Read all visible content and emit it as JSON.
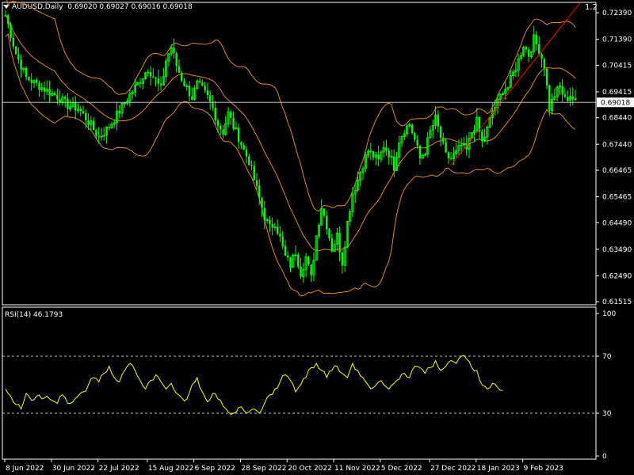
{
  "header": {
    "symbol": "AUDUSD,Daily",
    "ohlc": "0.69020 0.69027 0.69016 0.69018"
  },
  "corner_label": "1.2",
  "rsi": {
    "label": "RSI(14) 46.1793",
    "levels": [
      100,
      70,
      30,
      0
    ],
    "period": 14,
    "value": 46.1793
  },
  "colors": {
    "bg": "#000000",
    "candle": "#00ff00",
    "bands": "#e08a1e",
    "rsi": "#ffff00",
    "trend": "#ff0000",
    "grid": "#ffffff",
    "price_line": "#c0c0c0"
  },
  "chart_data": {
    "type": "candlestick",
    "price_axis": {
      "ticks": [
        "0.72390",
        "0.71390",
        "0.70415",
        "0.69415",
        "0.68440",
        "0.67440",
        "0.66465",
        "0.65465",
        "0.64490",
        "0.63490",
        "0.62490",
        "0.61515"
      ],
      "range": [
        0.614,
        0.7278
      ],
      "current_price": "0.69018"
    },
    "time_axis": [
      "8 Jun 2022",
      "30 Jun 2022",
      "22 Jul 2022",
      "15 Aug 2022",
      "6 Sep 2022",
      "28 Sep 2022",
      "20 Oct 2022",
      "11 Nov 2022",
      "5 Dec 2022",
      "27 Dec 2022",
      "18 Jan 2023",
      "9 Feb 2023"
    ],
    "close_path": [
      [
        0,
        0.723
      ],
      [
        4,
        0.7085
      ],
      [
        8,
        0.6995
      ],
      [
        12,
        0.697
      ],
      [
        16,
        0.6945
      ],
      [
        20,
        0.6925
      ],
      [
        24,
        0.689
      ],
      [
        28,
        0.688
      ],
      [
        30,
        0.6855
      ],
      [
        33,
        0.6815
      ],
      [
        36,
        0.677
      ],
      [
        40,
        0.681
      ],
      [
        44,
        0.687
      ],
      [
        48,
        0.693
      ],
      [
        52,
        0.6985
      ],
      [
        55,
        0.703
      ],
      [
        58,
        0.6985
      ],
      [
        60,
        0.695
      ],
      [
        62,
        0.706
      ],
      [
        64,
        0.711
      ],
      [
        66,
        0.704
      ],
      [
        68,
        0.699
      ],
      [
        70,
        0.6955
      ],
      [
        72,
        0.692
      ],
      [
        74,
        0.697
      ],
      [
        76,
        0.695
      ],
      [
        78,
        0.692
      ],
      [
        80,
        0.688
      ],
      [
        82,
        0.682
      ],
      [
        84,
        0.679
      ],
      [
        86,
        0.686
      ],
      [
        88,
        0.681
      ],
      [
        90,
        0.677
      ],
      [
        92,
        0.672
      ],
      [
        94,
        0.668
      ],
      [
        96,
        0.661
      ],
      [
        98,
        0.654
      ],
      [
        100,
        0.647
      ],
      [
        102,
        0.643
      ],
      [
        104,
        0.645
      ],
      [
        106,
        0.639
      ],
      [
        108,
        0.632
      ],
      [
        110,
        0.629
      ],
      [
        112,
        0.634
      ],
      [
        114,
        0.626
      ],
      [
        116,
        0.632
      ],
      [
        118,
        0.624
      ],
      [
        120,
        0.64
      ],
      [
        122,
        0.651
      ],
      [
        124,
        0.644
      ],
      [
        126,
        0.635
      ],
      [
        128,
        0.64
      ],
      [
        130,
        0.63
      ],
      [
        132,
        0.645
      ],
      [
        134,
        0.656
      ],
      [
        136,
        0.661
      ],
      [
        138,
        0.667
      ],
      [
        140,
        0.672
      ],
      [
        142,
        0.67
      ],
      [
        144,
        0.668
      ],
      [
        146,
        0.674
      ],
      [
        148,
        0.671
      ],
      [
        150,
        0.666
      ],
      [
        152,
        0.676
      ],
      [
        154,
        0.68
      ],
      [
        156,
        0.682
      ],
      [
        158,
        0.676
      ],
      [
        160,
        0.669
      ],
      [
        162,
        0.672
      ],
      [
        164,
        0.679
      ],
      [
        166,
        0.684
      ],
      [
        168,
        0.677
      ],
      [
        170,
        0.67
      ],
      [
        172,
        0.669
      ],
      [
        174,
        0.671
      ],
      [
        176,
        0.674
      ],
      [
        178,
        0.672
      ],
      [
        180,
        0.679
      ],
      [
        182,
        0.683
      ],
      [
        184,
        0.675
      ],
      [
        186,
        0.68
      ],
      [
        188,
        0.687
      ],
      [
        190,
        0.69
      ],
      [
        192,
        0.695
      ],
      [
        194,
        0.696
      ],
      [
        196,
        0.701
      ],
      [
        198,
        0.706
      ],
      [
        200,
        0.712
      ],
      [
        202,
        0.708
      ],
      [
        204,
        0.714
      ],
      [
        206,
        0.71
      ],
      [
        208,
        0.704
      ],
      [
        210,
        0.688
      ],
      [
        212,
        0.693
      ],
      [
        214,
        0.696
      ],
      [
        216,
        0.691
      ],
      [
        218,
        0.693
      ],
      [
        220,
        0.6902
      ]
    ],
    "rsi_path": [
      [
        0,
        47
      ],
      [
        2,
        42
      ],
      [
        4,
        36
      ],
      [
        6,
        33
      ],
      [
        8,
        44
      ],
      [
        10,
        39
      ],
      [
        12,
        42
      ],
      [
        14,
        40
      ],
      [
        16,
        42
      ],
      [
        18,
        39
      ],
      [
        20,
        37
      ],
      [
        22,
        43
      ],
      [
        24,
        37
      ],
      [
        26,
        38
      ],
      [
        28,
        42
      ],
      [
        30,
        45
      ],
      [
        32,
        50
      ],
      [
        34,
        55
      ],
      [
        36,
        52
      ],
      [
        38,
        58
      ],
      [
        40,
        63
      ],
      [
        42,
        55
      ],
      [
        44,
        52
      ],
      [
        46,
        60
      ],
      [
        48,
        65
      ],
      [
        50,
        60
      ],
      [
        52,
        53
      ],
      [
        54,
        47
      ],
      [
        56,
        53
      ],
      [
        58,
        57
      ],
      [
        60,
        52
      ],
      [
        62,
        47
      ],
      [
        64,
        51
      ],
      [
        66,
        44
      ],
      [
        68,
        41
      ],
      [
        70,
        40
      ],
      [
        72,
        50
      ],
      [
        74,
        55
      ],
      [
        76,
        45
      ],
      [
        78,
        38
      ],
      [
        80,
        44
      ],
      [
        82,
        40
      ],
      [
        84,
        35
      ],
      [
        86,
        31
      ],
      [
        88,
        30
      ],
      [
        90,
        34
      ],
      [
        92,
        32
      ],
      [
        94,
        31
      ],
      [
        96,
        33
      ],
      [
        98,
        30
      ],
      [
        100,
        37
      ],
      [
        102,
        43
      ],
      [
        104,
        47
      ],
      [
        106,
        52
      ],
      [
        108,
        57
      ],
      [
        110,
        53
      ],
      [
        112,
        45
      ],
      [
        114,
        50
      ],
      [
        116,
        55
      ],
      [
        118,
        62
      ],
      [
        120,
        65
      ],
      [
        122,
        60
      ],
      [
        124,
        55
      ],
      [
        126,
        60
      ],
      [
        128,
        63
      ],
      [
        130,
        58
      ],
      [
        132,
        55
      ],
      [
        134,
        65
      ],
      [
        136,
        60
      ],
      [
        138,
        55
      ],
      [
        140,
        50
      ],
      [
        142,
        48
      ],
      [
        144,
        52
      ],
      [
        146,
        50
      ],
      [
        148,
        47
      ],
      [
        150,
        51
      ],
      [
        152,
        54
      ],
      [
        154,
        58
      ],
      [
        156,
        55
      ],
      [
        158,
        63
      ],
      [
        160,
        62
      ],
      [
        162,
        58
      ],
      [
        164,
        62
      ],
      [
        166,
        67
      ],
      [
        168,
        60
      ],
      [
        170,
        63
      ],
      [
        172,
        67
      ],
      [
        174,
        65
      ],
      [
        176,
        70
      ],
      [
        178,
        68
      ],
      [
        180,
        62
      ],
      [
        182,
        60
      ],
      [
        184,
        50
      ],
      [
        186,
        47
      ],
      [
        188,
        51
      ],
      [
        190,
        48
      ],
      [
        192,
        46
      ]
    ]
  },
  "trendline": {
    "from": [
      172,
      0.6665
    ],
    "to": [
      222,
      0.7278
    ]
  },
  "bands_note": "Bollinger-style envelope"
}
